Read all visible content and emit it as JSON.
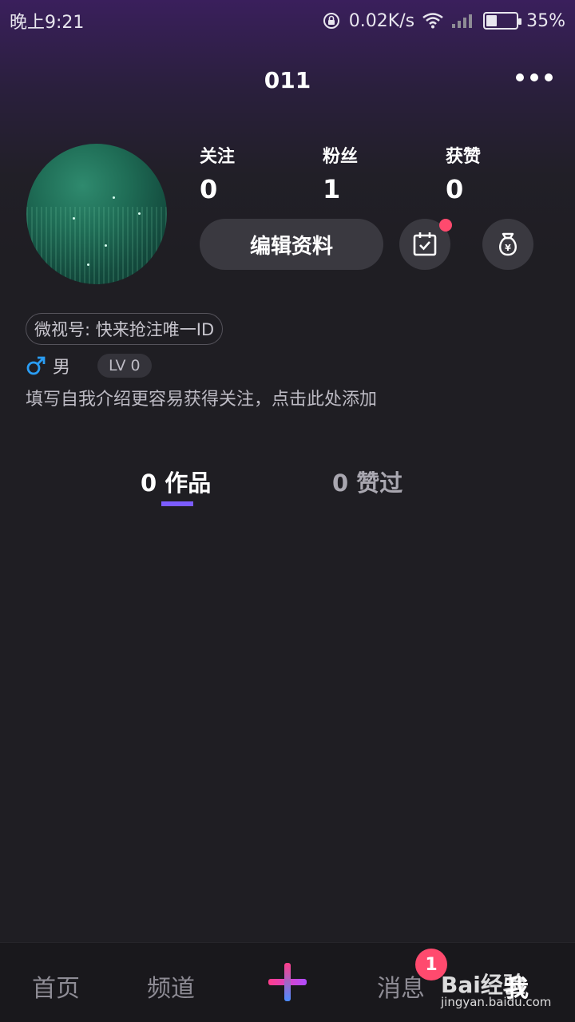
{
  "status_bar": {
    "time": "晚上9:21",
    "network_speed": "0.02K/s",
    "battery_percent": "35%",
    "battery_level": 0.35,
    "icons": [
      "rotation-lock-icon",
      "wifi-icon",
      "signal-icon",
      "battery-icon"
    ]
  },
  "header": {
    "title": "011",
    "more_icon": "more-dots-icon"
  },
  "profile": {
    "stats": [
      {
        "label": "关注",
        "value": "0"
      },
      {
        "label": "粉丝",
        "value": "1"
      },
      {
        "label": "获赞",
        "value": "0"
      }
    ],
    "edit_label": "编辑资料",
    "checkin_icon": "calendar-check-icon",
    "wallet_icon": "money-bag-icon",
    "weishi_id": "微视号: 快来抢注唯一ID",
    "gender": "男",
    "gender_icon": "male-icon",
    "level": "LV 0",
    "bio_placeholder": "填写自我介绍更容易获得关注，点击此处添加"
  },
  "tabs": [
    {
      "label": "0 作品",
      "active": true
    },
    {
      "label": "0 赞过",
      "active": false
    }
  ],
  "bottom_nav": {
    "items": [
      "首页",
      "频道",
      "消息",
      "我"
    ],
    "publish_icon": "plus-icon",
    "messages_badge": "1"
  },
  "watermark": {
    "logo": "Bai经验",
    "url": "jingyan.baidu.com"
  },
  "colors": {
    "accent": "#7b5cff",
    "badge": "#ff4a6e",
    "male": "#2a9df4"
  }
}
